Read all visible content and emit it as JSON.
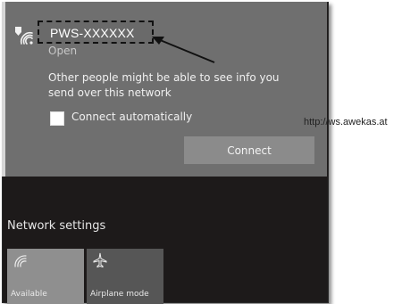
{
  "network": {
    "ssid": "PWS-XXXXXX",
    "status": "Open",
    "warning": "Other people might be able to see info you send over this network",
    "connect_auto_label": "Connect automatically",
    "connect_auto_checked": false,
    "connect_button": "Connect"
  },
  "watermark": "http://ws.awekas.at",
  "footer": {
    "settings_label": "Network settings",
    "tiles": [
      {
        "label": "Available",
        "icon": "wifi-icon"
      },
      {
        "label": "Airplane mode",
        "icon": "airplane-icon"
      }
    ]
  },
  "colors": {
    "panel_bg": "#6f6f6f",
    "flyout_bg": "#1d1a1a",
    "button_bg": "#8b8b8b",
    "tile_active": "#8f8f8f",
    "tile_inactive": "#565656"
  }
}
